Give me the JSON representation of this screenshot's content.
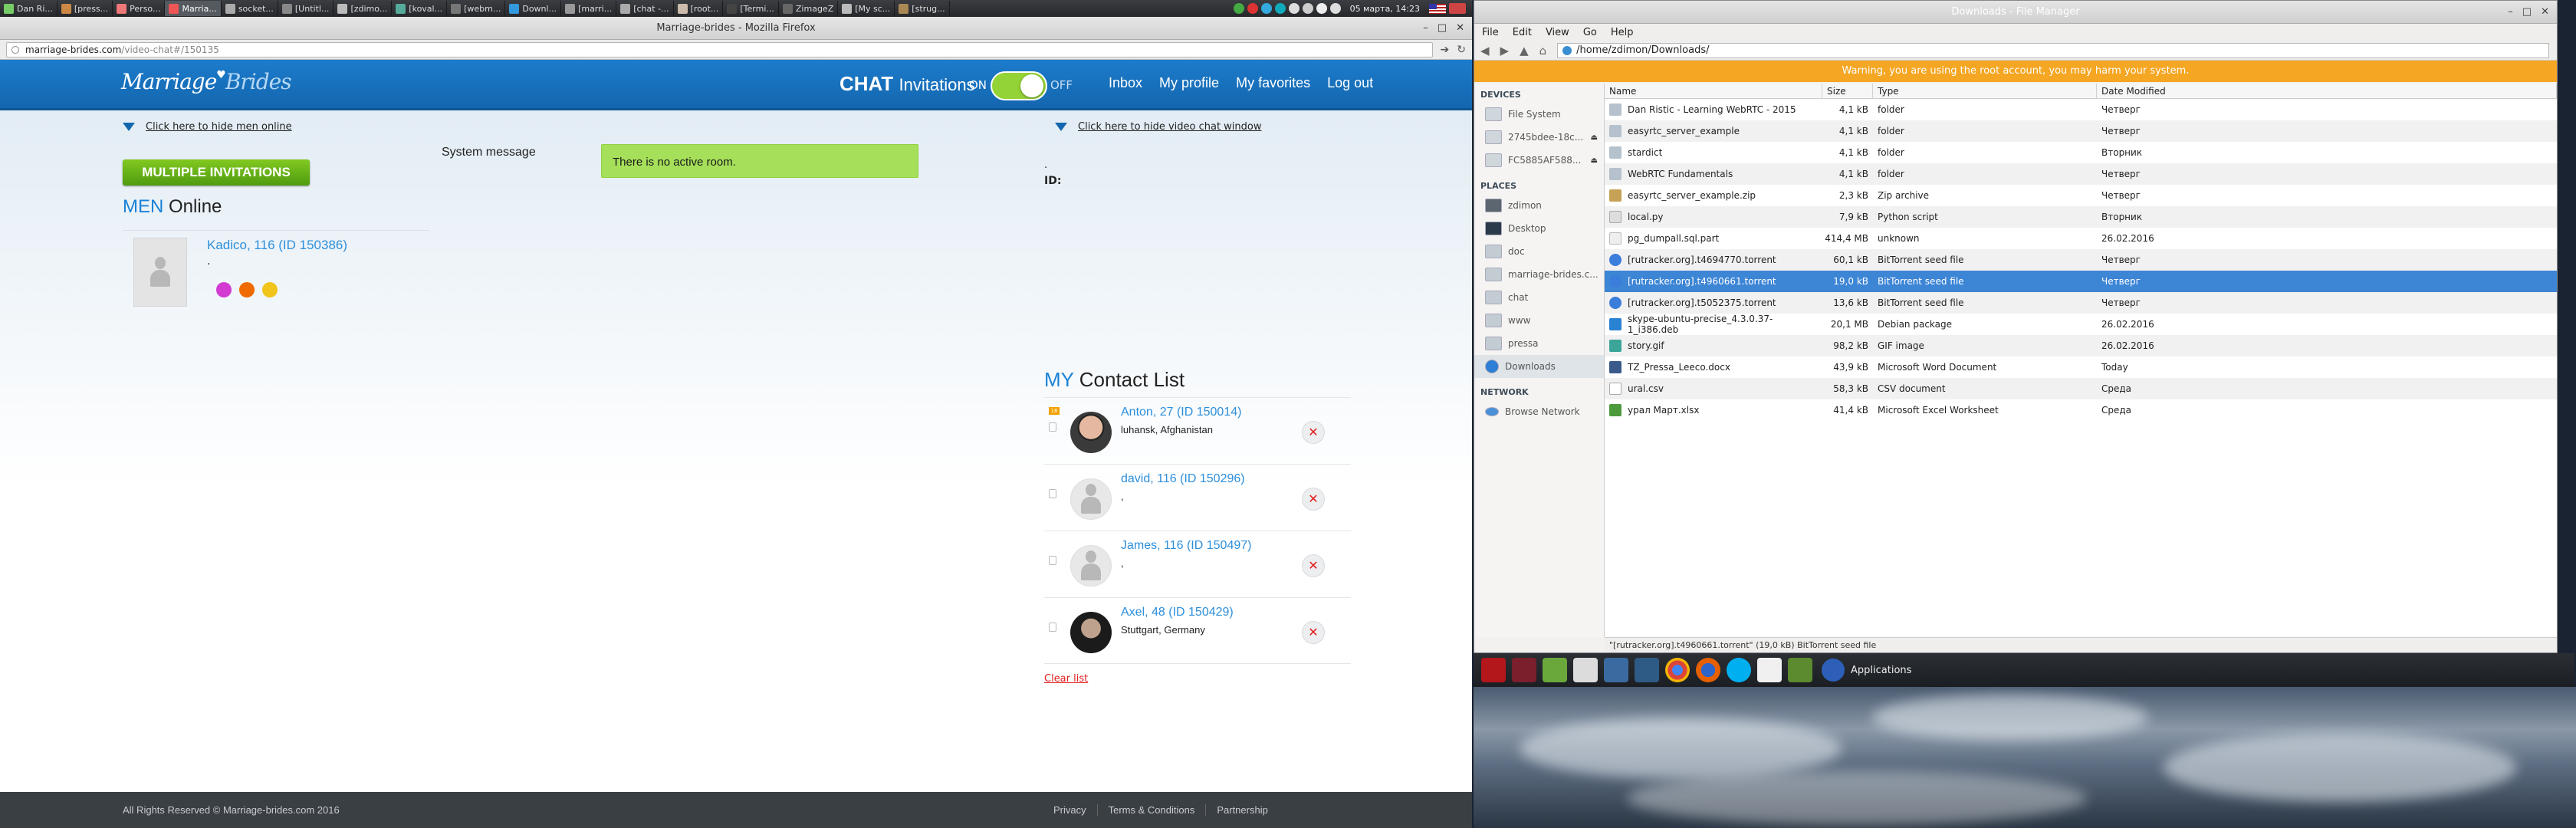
{
  "taskbar": {
    "items": [
      "Dan Ri...",
      "[press...",
      "Perso...",
      "Marria...",
      "socket...",
      "[Untitl...",
      "[zdimo...",
      "[koval...",
      "[webm...",
      "Downl...",
      "[marri...",
      "[chat -...",
      "[root...",
      "[Termi...",
      "ZimageZ",
      "[My sc...",
      "[strug..."
    ],
    "active_index": 3,
    "clock": "05 марта, 14:23"
  },
  "firefox": {
    "title": "Marriage-brides - Mozilla Firefox",
    "url_host": "marriage-brides.com",
    "url_path": "/video-chat#/150135"
  },
  "site": {
    "logo_a": "Marriage",
    "logo_b": "Brides",
    "chat_bold": "CHAT",
    "chat_thin": "Invitations",
    "toggle_on": "ON",
    "toggle_off": "OFF",
    "nav": [
      "Inbox",
      "My profile",
      "My favorites",
      "Log out"
    ],
    "hide_men": "Click here to hide men online",
    "hide_video": "Click here to hide video chat window",
    "multi_btn": "MULTIPLE INVITATIONS",
    "men_pre": "MEN",
    "men_title": "Online",
    "online_user": {
      "name": "Kadico, 116 (ID 150386)",
      "dot": "."
    },
    "system_message_label": "System message",
    "system_message": "There is no active room.",
    "video_dot": ".",
    "video_id": "ID:",
    "contact_pre": "MY",
    "contact_title": "Contact List",
    "contacts": [
      {
        "name": "Anton, 27 (ID 150014)",
        "loc": "luhansk, Afghanistan"
      },
      {
        "name": "david, 116 (ID 150296)",
        "loc": ","
      },
      {
        "name": "James, 116 (ID 150497)",
        "loc": ","
      },
      {
        "name": "Axel, 48 (ID 150429)",
        "loc": "Stuttgart, Germany"
      }
    ],
    "clear_list": "Clear list",
    "footer_copy": "All Rights Reserved © Marriage-brides.com 2016",
    "footer_links": [
      "Privacy",
      "Terms & Conditions",
      "Partnership"
    ]
  },
  "file_manager": {
    "title": "Downloads - File Manager",
    "menu": [
      "File",
      "Edit",
      "View",
      "Go",
      "Help"
    ],
    "path": "/home/zdimon/Downloads/",
    "warning": "Warning, you are using the root account, you may harm your system.",
    "sections": {
      "devices": "DEVICES",
      "places": "PLACES",
      "network": "NETWORK"
    },
    "devices": [
      "File System",
      "2745bdee-18c...",
      "FC5885AF588..."
    ],
    "places": [
      "zdimon",
      "Desktop",
      "doc",
      "marriage-brides.c...",
      "chat",
      "www",
      "pressa",
      "Downloads"
    ],
    "network": [
      "Browse Network"
    ],
    "columns": [
      "Name",
      "Size",
      "Type",
      "Date Modified"
    ],
    "rows": [
      {
        "name": "Dan Ristic - Learning WebRTC - 2015",
        "size": "4,1 kB",
        "type": "folder",
        "mod": "Четверг",
        "icon": "folder"
      },
      {
        "name": "easyrtc_server_example",
        "size": "4,1 kB",
        "type": "folder",
        "mod": "Четверг",
        "icon": "folder"
      },
      {
        "name": "stardict",
        "size": "4,1 kB",
        "type": "folder",
        "mod": "Вторник",
        "icon": "folder"
      },
      {
        "name": "WebRTC Fundamentals",
        "size": "4,1 kB",
        "type": "folder",
        "mod": "Четверг",
        "icon": "folder"
      },
      {
        "name": "easyrtc_server_example.zip",
        "size": "2,3 kB",
        "type": "Zip archive",
        "mod": "Четверг",
        "icon": "zip"
      },
      {
        "name": "local.py",
        "size": "7,9 kB",
        "type": "Python script",
        "mod": "Вторник",
        "icon": "py"
      },
      {
        "name": "pg_dumpall.sql.part",
        "size": "414,4 MB",
        "type": "unknown",
        "mod": "26.02.2016",
        "icon": "unk"
      },
      {
        "name": "[rutracker.org].t4694770.torrent",
        "size": "60,1 kB",
        "type": "BitTorrent seed file",
        "mod": "Четверг",
        "icon": "tor"
      },
      {
        "name": "[rutracker.org].t4960661.torrent",
        "size": "19,0 kB",
        "type": "BitTorrent seed file",
        "mod": "Четверг",
        "icon": "tor"
      },
      {
        "name": "[rutracker.org].t5052375.torrent",
        "size": "13,6 kB",
        "type": "BitTorrent seed file",
        "mod": "Четверг",
        "icon": "tor"
      },
      {
        "name": "skype-ubuntu-precise_4.3.0.37-1_i386.deb",
        "size": "20,1 MB",
        "type": "Debian package",
        "mod": "26.02.2016",
        "icon": "deb"
      },
      {
        "name": "story.gif",
        "size": "98,2 kB",
        "type": "GIF image",
        "mod": "26.02.2016",
        "icon": "gif"
      },
      {
        "name": "TZ_Pressa_Leeco.docx",
        "size": "43,9 kB",
        "type": "Microsoft Word Document",
        "mod": "Today",
        "icon": "doc"
      },
      {
        "name": "ural.csv",
        "size": "58,3 kB",
        "type": "CSV document",
        "mod": "Среда",
        "icon": "csv"
      },
      {
        "name": "урал Март.xlsx",
        "size": "41,4 kB",
        "type": "Microsoft Excel Worksheet",
        "mod": "Среда",
        "icon": "xls"
      }
    ],
    "selected_row": 8,
    "status": "\"[rutracker.org].t4960661.torrent\" (19,0 kB) BitTorrent seed file"
  },
  "dock": {
    "applications": "Applications"
  }
}
